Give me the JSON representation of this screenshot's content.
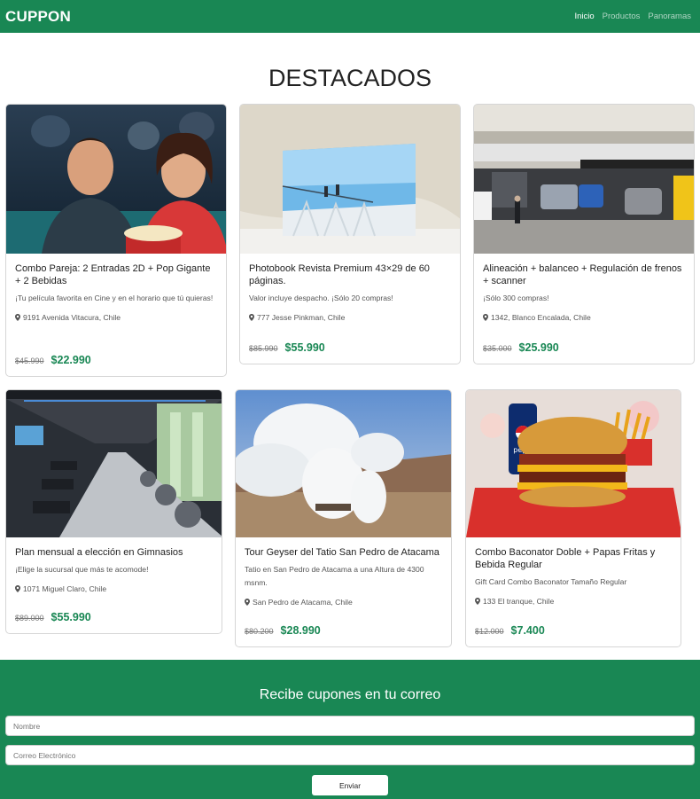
{
  "navbar": {
    "brand": "CUPPON",
    "links": [
      {
        "label": "Inicio",
        "active": true
      },
      {
        "label": "Productos",
        "active": false
      },
      {
        "label": "Panoramas",
        "active": false
      }
    ]
  },
  "section": {
    "title": "DESTACADOS"
  },
  "cards": [
    {
      "title": "Combo Pareja: 2 Entradas 2D + Pop Gigante + 2 Bebidas",
      "description": "¡Tu película favorita en Cine y en el horario que tú quieras!",
      "location": "9191 Avenida Vitacura, Chile",
      "old_price": "$45.990",
      "new_price": "$22.990",
      "image": "cinema-couple-popcorn-image"
    },
    {
      "title": "Photobook Revista Premium 43×29 de 60 páginas.",
      "description": "Valor incluye despacho. ¡Sólo 20 compras!",
      "location": "777 Jesse Pinkman, Chile",
      "old_price": "$85.990",
      "new_price": "$55.990",
      "image": "photobook-image"
    },
    {
      "title": "Alineación + balanceo + Regulación de frenos + scanner",
      "description": "¡Sólo 300 compras!",
      "location": "1342, Blanco Encalada, Chile",
      "old_price": "$35.000",
      "new_price": "$25.990",
      "image": "auto-service-garage-image"
    },
    {
      "title": "Plan mensual a elección en Gimnasios",
      "description": "¡Elige la sucursal que más te acomode!",
      "location": "1071 Miguel Claro, Chile",
      "old_price": "$89.000",
      "new_price": "$55.990",
      "image": "gym-treadmills-image"
    },
    {
      "title": "Tour Geyser del Tatio San Pedro de Atacama",
      "description": "Tatio en San Pedro de Atacama a una Altura de 4300 msnm.",
      "location": "San Pedro de Atacama, Chile",
      "old_price": "$80.200",
      "new_price": "$28.990",
      "image": "geyser-landscape-image"
    },
    {
      "title": "Combo Baconator Doble + Papas Fritas y Bebida Regular",
      "description": "Gift Card Combo Baconator Tamaño Regular",
      "location": "133 El tranque, Chile",
      "old_price": "$12.000",
      "new_price": "$7.400",
      "image": "burger-combo-image"
    }
  ],
  "newsletter": {
    "title": "Recibe cupones en tu correo",
    "name_placeholder": "Nombre",
    "email_placeholder": "Correo Electrónico",
    "submit_label": "Enviar"
  },
  "pepsi_can_text": "pepsi"
}
